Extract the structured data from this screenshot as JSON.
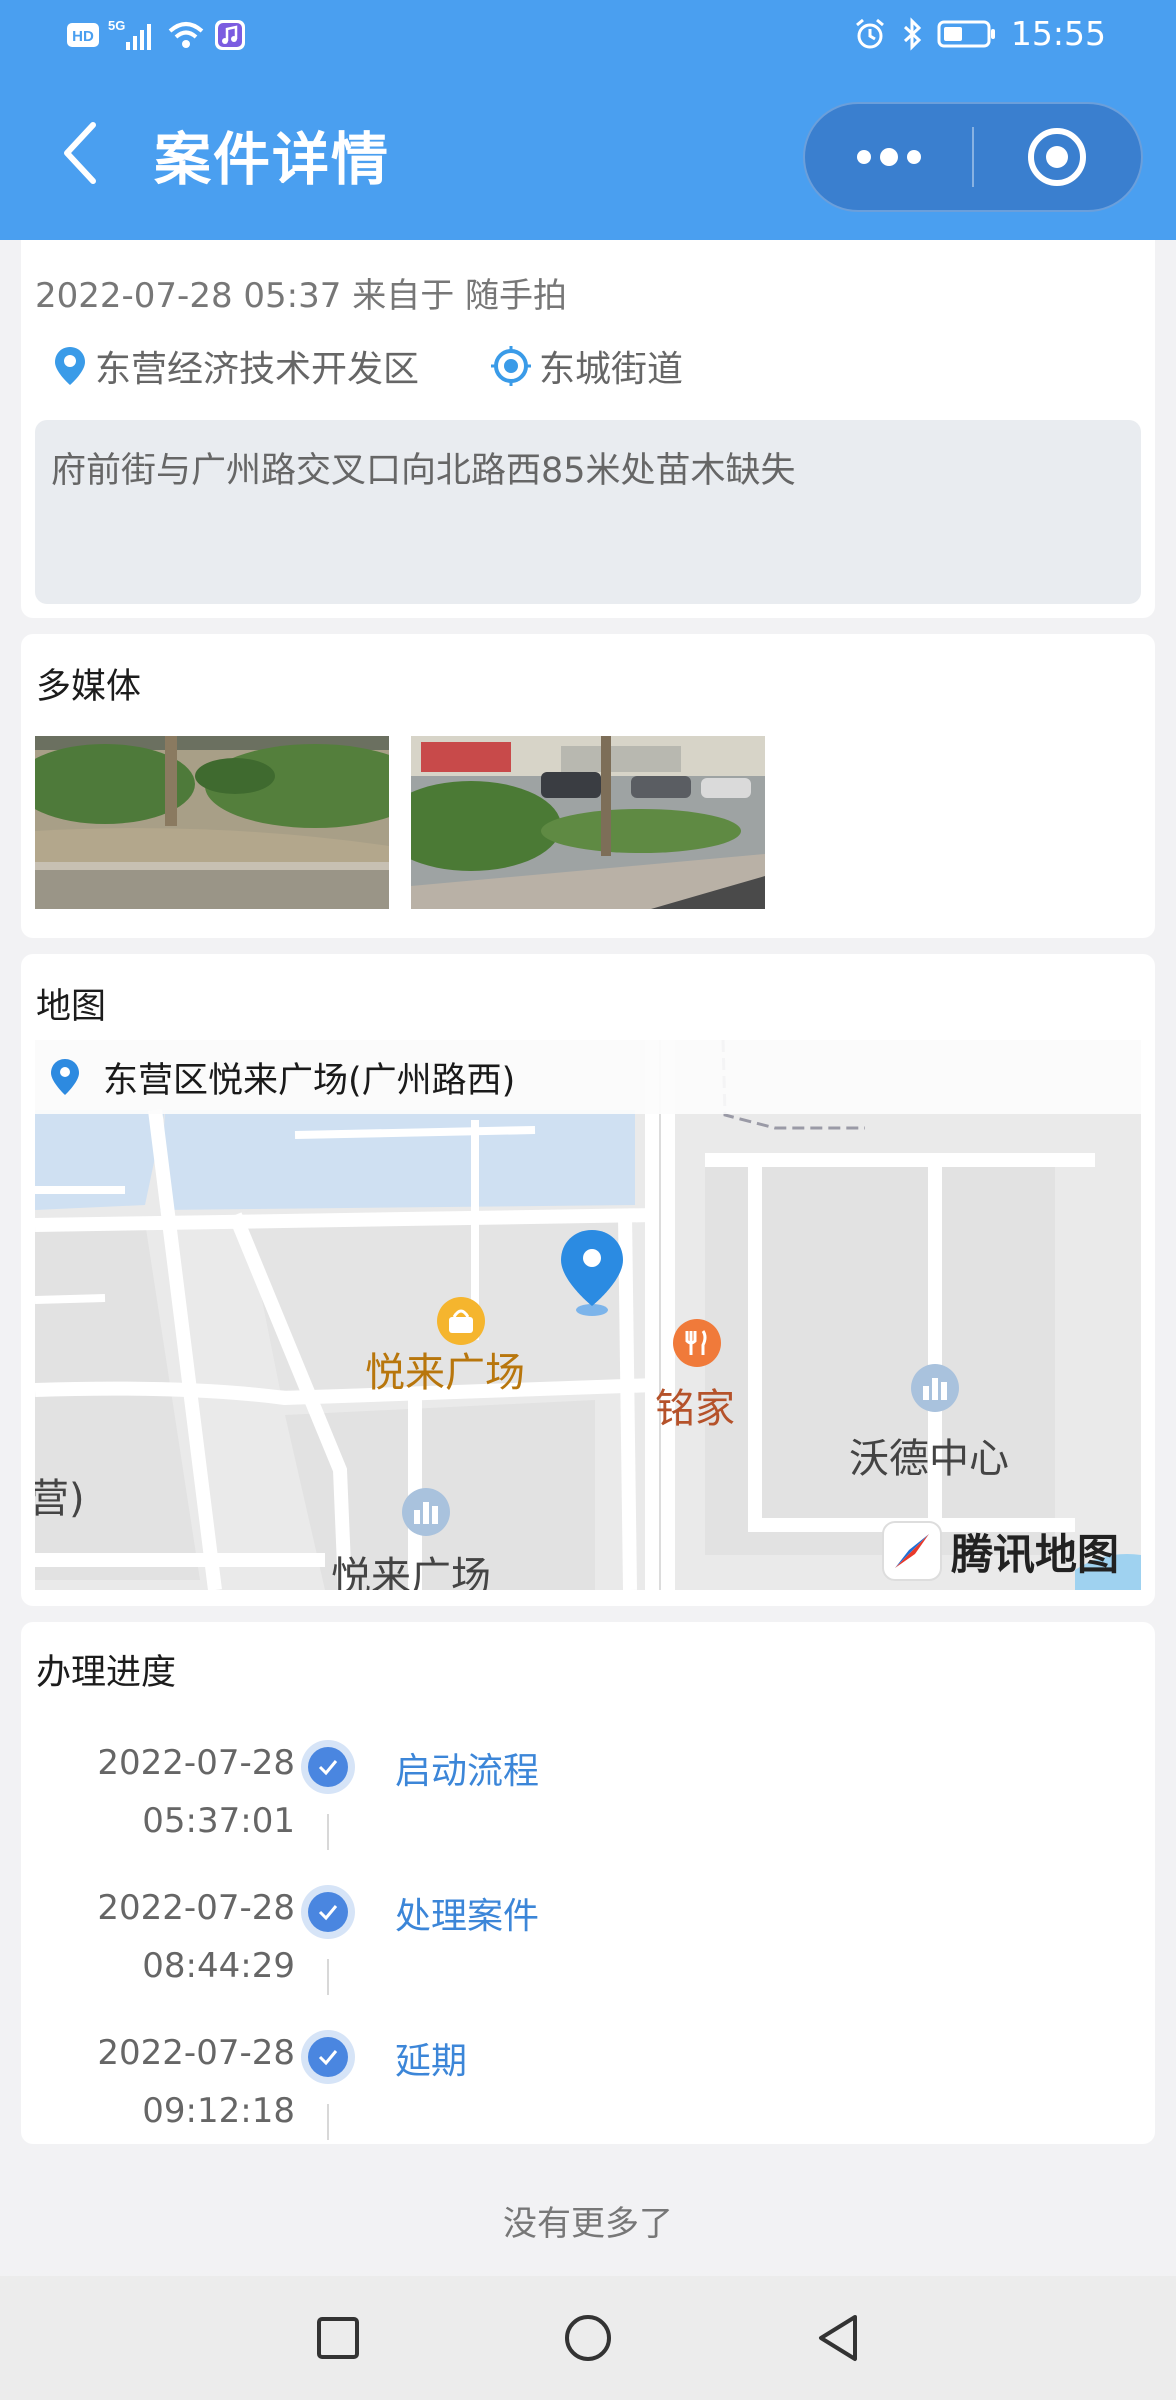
{
  "status_bar": {
    "hd_label": "HD",
    "network_label": "5G",
    "time": "15:55"
  },
  "header": {
    "title": "案件详情"
  },
  "case": {
    "meta": "2022-07-28 05:37 来自于 随手拍",
    "district": "东营经济技术开发区",
    "street": "东城街道",
    "description": "府前街与广州路交叉口向北路西85米处苗木缺失"
  },
  "media": {
    "title": "多媒体"
  },
  "map": {
    "title": "地图",
    "address": "东营区悦来广场(广州路西)",
    "poi_1": "悦来广场",
    "poi_2": "铭家",
    "poi_3": "沃德中心",
    "poi_4": "悦来广场",
    "poi_5": "营)",
    "logo_text": "腾讯地图"
  },
  "progress": {
    "title": "办理进度",
    "steps": [
      {
        "date": "2022-07-28",
        "time": "05:37:01",
        "label": "启动流程"
      },
      {
        "date": "2022-07-28",
        "time": "08:44:29",
        "label": "处理案件"
      },
      {
        "date": "2022-07-28",
        "time": "09:12:18",
        "label": "延期"
      }
    ]
  },
  "footer": {
    "no_more": "没有更多了"
  },
  "colors": {
    "header_bg": "#4a9ff0",
    "link_blue": "#3c86d8",
    "check_blue": "#4a86e0"
  }
}
